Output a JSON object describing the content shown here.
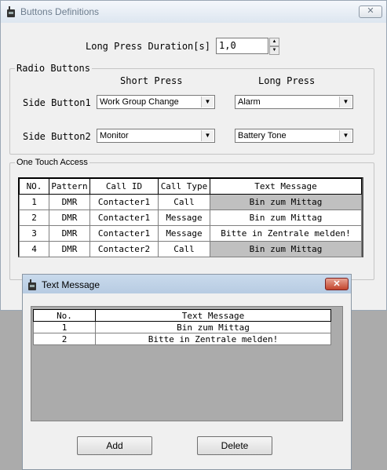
{
  "main_window": {
    "title": "Buttons Definitions",
    "close_label": "✕",
    "long_press_duration": {
      "label": "Long Press Duration[s]",
      "value": "1,0"
    },
    "radio_buttons": {
      "group_title": "Radio Buttons",
      "short_press_header": "Short Press",
      "long_press_header": "Long Press",
      "side_button1": {
        "label": "Side Button1",
        "short": "Work Group Change",
        "long": "Alarm"
      },
      "side_button2": {
        "label": "Side Button2",
        "short": "Monitor",
        "long": "Battery Tone"
      }
    },
    "one_touch": {
      "group_title": "One Touch Access",
      "columns": [
        "NO.",
        "Pattern",
        "Call ID",
        "Call Type",
        "Text Message"
      ],
      "rows": [
        [
          "1",
          "DMR",
          "Contacter1",
          "Call",
          "Bin zum Mittag"
        ],
        [
          "2",
          "DMR",
          "Contacter1",
          "Message",
          "Bin zum Mittag"
        ],
        [
          "3",
          "DMR",
          "Contacter1",
          "Message",
          "Bitte in Zentrale melden!"
        ],
        [
          "4",
          "DMR",
          "Contacter2",
          "Call",
          "Bin zum Mittag"
        ]
      ]
    }
  },
  "text_message_dialog": {
    "title": "Text Message",
    "close_label": "✕",
    "columns": [
      "No.",
      "Text Message"
    ],
    "rows": [
      [
        "1",
        "Bin zum Mittag"
      ],
      [
        "2",
        "Bitte in Zentrale melden!"
      ]
    ],
    "add_label": "Add",
    "delete_label": "Delete"
  },
  "colors": {
    "selected_cell": "#c0c0c0",
    "dialog_close": "#c2442c",
    "desktop": "#ababab"
  },
  "icons": {
    "app": "radio-icon",
    "close": "close-icon",
    "dropdown": "chevron-down-icon"
  }
}
